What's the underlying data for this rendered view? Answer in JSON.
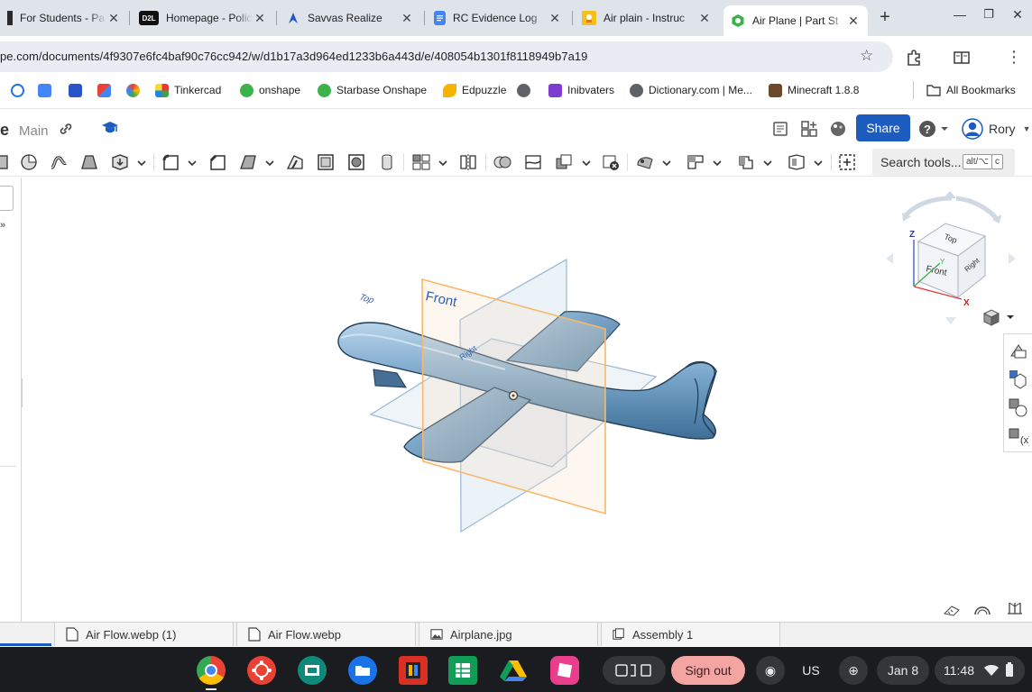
{
  "browser": {
    "tabs": [
      {
        "title": "For Students - Pa",
        "icon": "sm-icon"
      },
      {
        "title": "Homepage - Polic",
        "icon": "d2l-icon"
      },
      {
        "title": "Savvas Realize",
        "icon": "savvas-icon"
      },
      {
        "title": "RC Evidence Log",
        "icon": "docs-icon"
      },
      {
        "title": "Air plain - Instruc",
        "icon": "instructables-icon"
      },
      {
        "title": "Air Plane | Part St",
        "icon": "onshape-icon"
      }
    ],
    "favicon_text": {
      "d2l": "D2L"
    },
    "url": "pe.com/documents/4f9307e6fc4baf90c76cc942/w/d1b17a3d964ed1233b6a443d/e/408054b1301f8118949b7a19",
    "bookmarks": [
      "Tinkercad",
      "onshape",
      "Starbase Onshape",
      "Edpuzzle",
      "Inibvaters",
      "Dictionary.com | Me...",
      "Minecraft 1.8.8"
    ],
    "all_bookmarks": "All Bookmarks"
  },
  "onshape": {
    "doc_name_fragment": "e",
    "branch": "Main",
    "share_label": "Share",
    "user_name": "Rory",
    "search_tools": "Search tools...",
    "search_kbd_1": "alt/⌥",
    "search_kbd_2": "c",
    "planes": {
      "front": "Front",
      "top": "Top",
      "right": "Right"
    },
    "viewcube": {
      "top": "Top",
      "front": "Front",
      "right": "Right",
      "axis_z": "Z",
      "axis_x": "X",
      "axis_y": "Y"
    }
  },
  "doc_tabs": [
    {
      "label": "Air Flow.webp (1)",
      "icon": "file-icon"
    },
    {
      "label": "Air Flow.webp",
      "icon": "file-icon"
    },
    {
      "label": "Airplane.jpg",
      "icon": "image-icon"
    },
    {
      "label": "Assembly 1",
      "icon": "assembly-icon"
    }
  ],
  "shelf": {
    "sign_out": "Sign out",
    "locale": "US",
    "date": "Jan 8",
    "time": "11:48"
  },
  "colors": {
    "share_blue": "#1d5cbf",
    "plane_body": "#6f9fc4",
    "front_plane": "#f7b86e",
    "ref_plane": "#9fbad6"
  }
}
